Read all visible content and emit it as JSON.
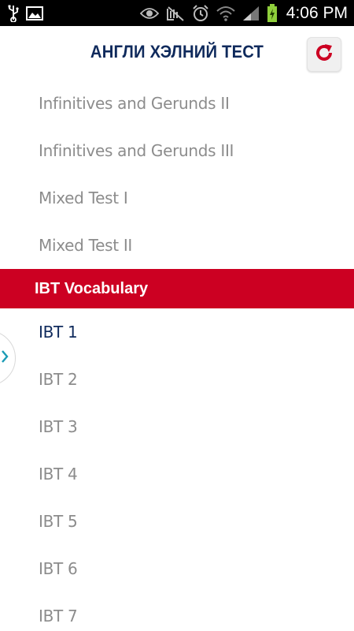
{
  "status_bar": {
    "time": "4:06 PM",
    "left_icons": [
      "usb-icon",
      "image-icon"
    ],
    "right_icons": [
      "eye-icon",
      "mute-icon",
      "alarm-icon",
      "wifi-icon",
      "signal-icon",
      "battery-charging-icon"
    ]
  },
  "header": {
    "title": "АНГЛИ ХЭЛНИЙ ТЕСТ",
    "refresh_icon": "refresh-icon"
  },
  "list": {
    "items_before": [
      "Infinitives and Gerunds II",
      "Infinitives and Gerunds III",
      "Mixed Test I",
      "Mixed Test II"
    ],
    "section_label": "IBT Vocabulary",
    "items_after": [
      "IBT 1",
      "IBT 2",
      "IBT 3",
      "IBT 4",
      "IBT 5",
      "IBT 6",
      "IBT 7"
    ],
    "active_item": "IBT 1"
  },
  "colors": {
    "accent_red": "#cc0022",
    "title_navy": "#0f2a5c",
    "item_gray": "#8c8c8c"
  }
}
